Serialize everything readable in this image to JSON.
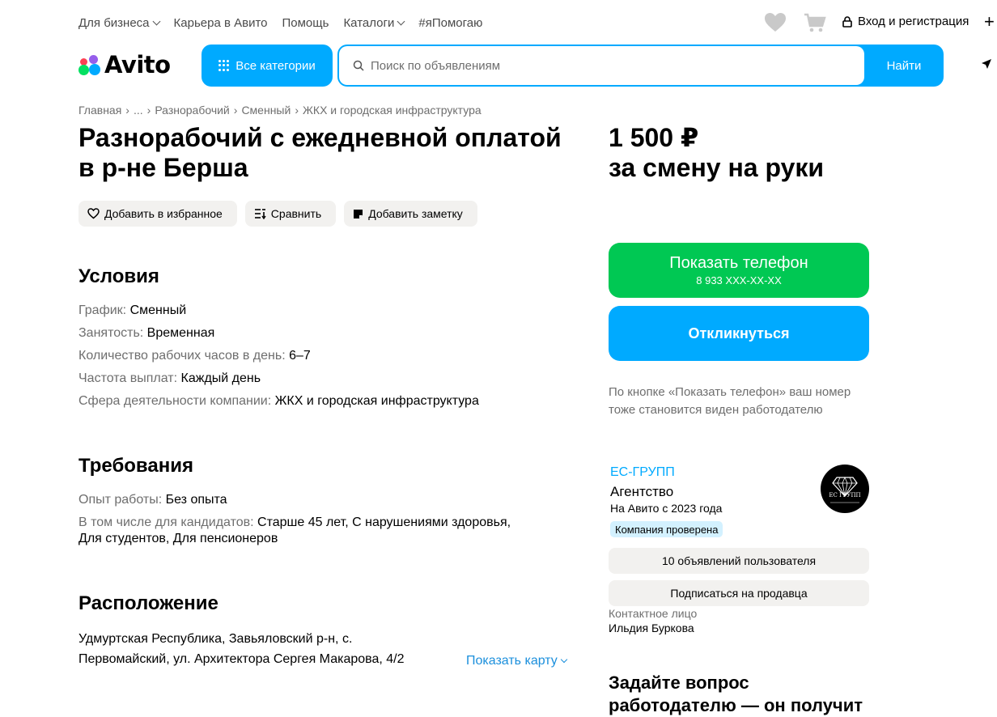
{
  "topnav": {
    "items": [
      "Для бизнеса",
      "Карьера в Авито",
      "Помощь",
      "Каталоги",
      "#яПомогаю"
    ],
    "login": "Вход и регистрация"
  },
  "header": {
    "logo_text": "Avito",
    "all_categories": "Все категории",
    "search_placeholder": "Поиск по объявлениям",
    "search_button": "Найти"
  },
  "breadcrumbs": [
    "Главная",
    "...",
    "Разнорабочий",
    "Сменный",
    "ЖКХ и городская инфраструктура"
  ],
  "listing": {
    "title_line1": "Разнорабочий с ежедневной оплатой",
    "title_line2": "в р-не Берша",
    "price_line1": "1 500 ₽",
    "price_line2": "за смену на руки",
    "actions": {
      "favorite": "Добавить в избранное",
      "compare": "Сравнить",
      "note": "Добавить заметку"
    }
  },
  "conditions": {
    "heading": "Условия",
    "rows": [
      {
        "k": "График: ",
        "v": "Сменный"
      },
      {
        "k": "Занятость: ",
        "v": "Временная"
      },
      {
        "k": "Количество рабочих часов в день: ",
        "v": "6–7"
      },
      {
        "k": "Частота выплат: ",
        "v": "Каждый день"
      },
      {
        "k": "Сфера деятельности компании: ",
        "v": "ЖКХ и городская инфраструктура"
      }
    ]
  },
  "requirements": {
    "heading": "Требования",
    "experience_k": "Опыт работы: ",
    "experience_v": "Без опыта",
    "candidates_k": "В том числе для кандидатов: ",
    "candidates_v1": "Старше 45 лет, С нарушениями здоровья,",
    "candidates_v2": "Для студентов, Для пенсионеров"
  },
  "location": {
    "heading": "Расположение",
    "address_line1": "Удмуртская Республика, Завьяловский р-н, с.",
    "address_line2": "Первомайский, ул. Архитектора Сергея Макарова, 4/2",
    "show_map": "Показать карту"
  },
  "contact_panel": {
    "show_phone": "Показать телефон",
    "phone_masked": "8 933 XXX-XX-XX",
    "respond": "Откликнуться",
    "note": "По кнопке «Показать телефон» ваш номер тоже становится виден работодателю",
    "seller_name": "ЕС-ГРУПП",
    "seller_type": "Агентство",
    "seller_since": "На Авито с 2023 года",
    "verified_badge": "Компания проверена",
    "avatar_text": "ЕС ГРУПП",
    "listings_button": "10 объявлений пользователя",
    "subscribe_button": "Подписаться на продавца",
    "contact_label": "Контактное лицо",
    "contact_name": "Ильдия Буркова",
    "ask_heading": "Задайте вопрос работодателю — он получит"
  },
  "colors": {
    "accent_blue": "#00aaff",
    "phone_green": "#00c853",
    "chip_bg": "#f2f1ef",
    "badge_bg": "#d3f1ff"
  }
}
